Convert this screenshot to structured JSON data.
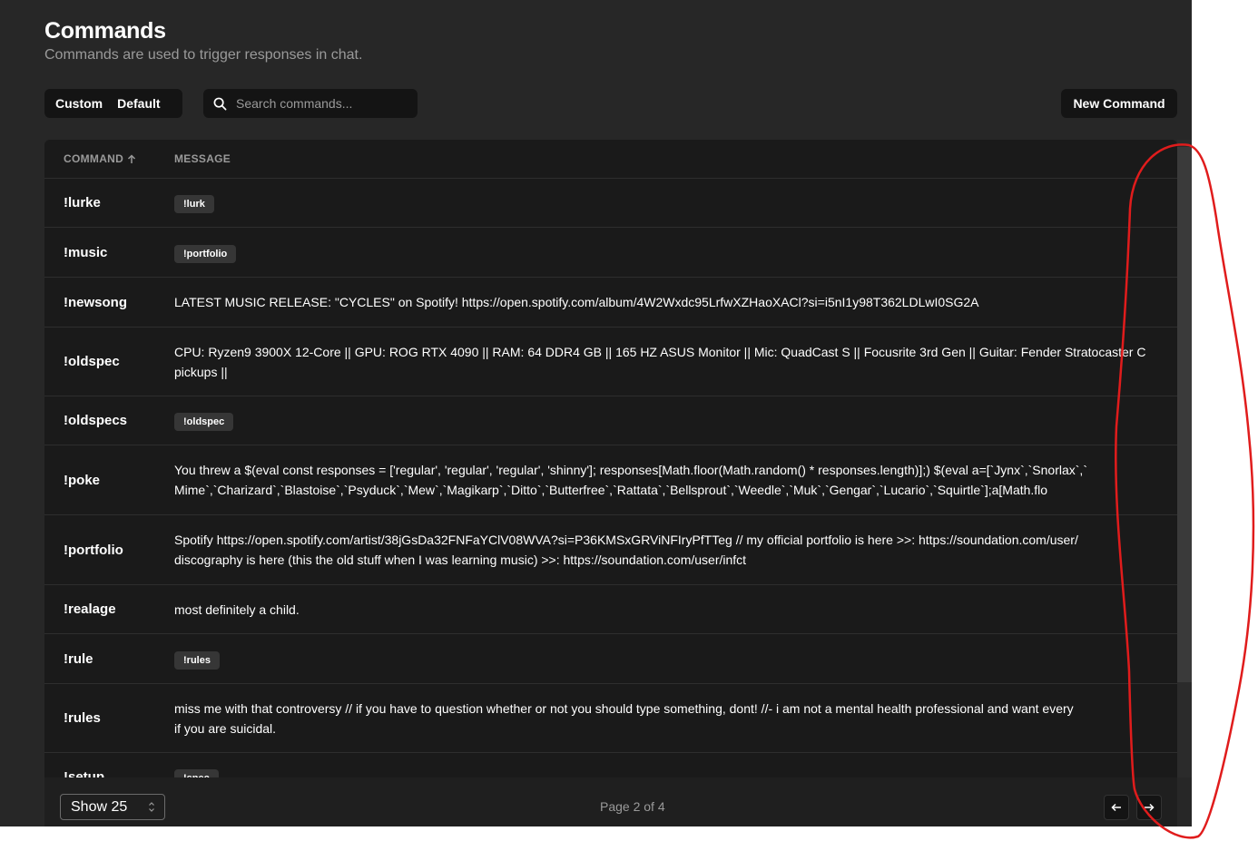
{
  "header": {
    "title": "Commands",
    "subtitle": "Commands are used to trigger responses in chat."
  },
  "toolbar": {
    "tabs": [
      {
        "label": "Custom"
      },
      {
        "label": "Default"
      }
    ],
    "search_placeholder": "Search commands...",
    "new_button": "New Command"
  },
  "table": {
    "columns": {
      "command": "COMMAND",
      "message": "MESSAGE"
    },
    "rows": [
      {
        "command": "!lurke",
        "badge": "!lurk"
      },
      {
        "command": "!music",
        "badge": "!portfolio"
      },
      {
        "command": "!newsong",
        "lines": [
          "LATEST MUSIC RELEASE: \"CYCLES\" on Spotify! https://open.spotify.com/album/4W2Wxdc95LrfwXZHaoXACl?si=i5nI1y98T362LDLwI0SG2A"
        ]
      },
      {
        "command": "!oldspec",
        "lines": [
          "CPU: Ryzen9 3900X 12-Core || GPU: ROG RTX 4090 || RAM: 64 DDR4 GB || 165 HZ ASUS Monitor || Mic: QuadCast S || Focusrite 3rd Gen || Guitar: Fender Stratocaster C",
          "pickups ||"
        ]
      },
      {
        "command": "!oldspecs",
        "badge": "!oldspec"
      },
      {
        "command": "!poke",
        "lines": [
          "You threw a $(eval const responses = ['regular', 'regular', 'regular', 'shinny']; responses[Math.floor(Math.random() * responses.length)];) $(eval a=[`Jynx`,`Snorlax`,`",
          "Mime`,`Charizard`,`Blastoise`,`Psyduck`,`Mew`,`Magikarp`,`Ditto`,`Butterfree`,`Rattata`,`Bellsprout`,`Weedle`,`Muk`,`Gengar`,`Lucario`,`Squirtle`];a[Math.flo"
        ]
      },
      {
        "command": "!portfolio",
        "lines": [
          "Spotify https://open.spotify.com/artist/38jGsDa32FNFaYClV08WVA?si=P36KMSxGRViNFIryPfTTeg // my official portfolio is here >>: https://soundation.com/user/",
          "discography is here (this the old stuff when I was learning music) >>: https://soundation.com/user/infct"
        ]
      },
      {
        "command": "!realage",
        "lines": [
          "most definitely a child."
        ]
      },
      {
        "command": "!rule",
        "badge": "!rules"
      },
      {
        "command": "!rules",
        "lines": [
          "miss me with that controversy // if you have to question whether or not you should type something, dont! //- i am not a mental health professional and want every",
          "if you are suicidal."
        ]
      },
      {
        "command": "!setup",
        "badge": "!spec"
      }
    ]
  },
  "footer": {
    "show_label": "Show 25",
    "page_info": "Page 2 of 4"
  }
}
